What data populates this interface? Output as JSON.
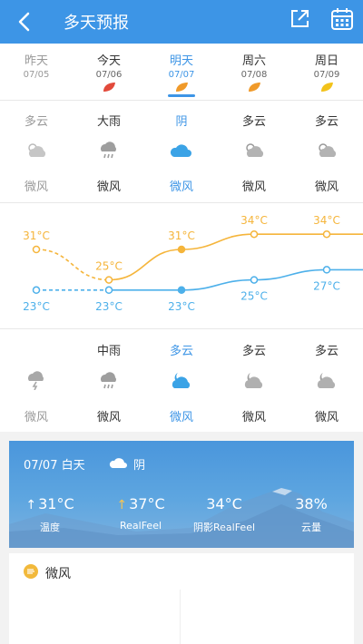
{
  "header": {
    "title": "多天预报",
    "back_icon": "chevron-left-icon",
    "share_icon": "share-icon",
    "calendar_icon": "calendar-icon",
    "bg": "#3d95e6"
  },
  "days": [
    {
      "name": "昨天",
      "date": "07/05",
      "leaf_color": "",
      "state": "past"
    },
    {
      "name": "今天",
      "date": "07/06",
      "leaf_color": "#e24a3b",
      "state": "normal"
    },
    {
      "name": "明天",
      "date": "07/07",
      "leaf_color": "#f09a2a",
      "state": "selected"
    },
    {
      "name": "周六",
      "date": "07/08",
      "leaf_color": "#f09a2a",
      "state": "normal"
    },
    {
      "name": "周日",
      "date": "07/09",
      "leaf_color": "#f2c21a",
      "state": "normal"
    }
  ],
  "day_weather": [
    {
      "cond": "多云",
      "icon": "partly-cloudy-icon",
      "wind": "微风"
    },
    {
      "cond": "大雨",
      "icon": "rain-icon",
      "wind": "微风"
    },
    {
      "cond": "阴",
      "icon": "cloud-icon",
      "wind": "微风"
    },
    {
      "cond": "多云",
      "icon": "partly-cloudy-icon",
      "wind": "微风"
    },
    {
      "cond": "多云",
      "icon": "partly-cloudy-icon",
      "wind": "微风"
    }
  ],
  "chart_data": {
    "type": "line",
    "categories": [
      "07/05",
      "07/06",
      "07/07",
      "07/08",
      "07/09"
    ],
    "series": [
      {
        "values": [
          31,
          25,
          31,
          34,
          34
        ],
        "color": "#f5b53b"
      },
      {
        "values": [
          23,
          23,
          23,
          25,
          27
        ],
        "color": "#4db0ea"
      }
    ],
    "high_labels": [
      "31°C",
      "25°C",
      "31°C",
      "34°C",
      "34°C"
    ],
    "low_labels": [
      "23°C",
      "23°C",
      "23°C",
      "25°C",
      "27°C"
    ]
  },
  "night_weather": [
    {
      "cond": "",
      "icon": "thunderstorm-icon",
      "wind": "微风"
    },
    {
      "cond": "中雨",
      "icon": "rain-icon",
      "wind": "微风"
    },
    {
      "cond": "多云",
      "icon": "night-cloudy-icon",
      "wind": "微风"
    },
    {
      "cond": "多云",
      "icon": "night-cloudy-icon",
      "wind": "微风"
    },
    {
      "cond": "多云",
      "icon": "night-cloudy-icon",
      "wind": "微风"
    }
  ],
  "detail": {
    "date": "07/07 白天",
    "condition": "阴",
    "stats": [
      {
        "value": "31°C",
        "label": "温度",
        "arrow": "↑",
        "arrow_color": "#ffffff"
      },
      {
        "value": "37°C",
        "label": "RealFeel",
        "arrow": "↑",
        "arrow_color": "#f6c453"
      },
      {
        "value": "34°C",
        "label": "阴影RealFeel",
        "arrow": "",
        "arrow_color": ""
      },
      {
        "value": "38%",
        "label": "云量",
        "arrow": "",
        "arrow_color": ""
      }
    ]
  },
  "wind_section": {
    "label": "微风",
    "icon": "wind-icon"
  }
}
